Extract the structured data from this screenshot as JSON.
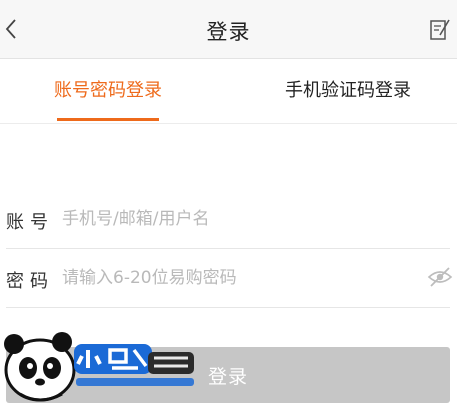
{
  "header": {
    "back_icon": "chevron-left-icon",
    "title": "登录",
    "edit_icon": "edit-note-icon"
  },
  "tabs": [
    {
      "label": "账号密码登录",
      "active": true
    },
    {
      "label": "手机验证码登录",
      "active": false
    }
  ],
  "form": {
    "account": {
      "label": "账号",
      "placeholder": "手机号/邮箱/用户名",
      "value": ""
    },
    "password": {
      "label": "密码",
      "placeholder": "请输入6-20位易购密码",
      "value": "",
      "toggle_icon": "eye-hidden-icon"
    }
  },
  "login_button": {
    "label": "登录"
  },
  "watermark": {
    "logo_text": "小黑游戏",
    "url": "www.xiaohei.com"
  },
  "colors": {
    "accent": "#ee6a1b",
    "button_disabled": "#c6c6c6",
    "header_bg": "#f7f7f7"
  }
}
